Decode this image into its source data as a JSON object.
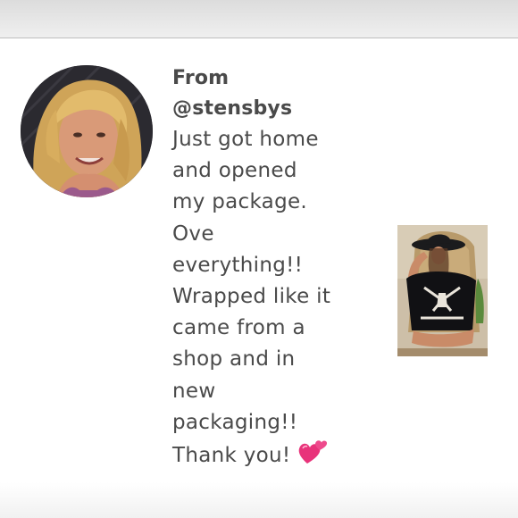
{
  "review": {
    "from_label": "From",
    "username": "@stensbys",
    "message_lines": [
      "Just got home",
      "and opened",
      "my package.",
      "Ove",
      "everything!!",
      "Wrapped like it",
      "came from a",
      "shop and in",
      "new",
      "packaging!!",
      "Thank you!"
    ],
    "emoji": "two-hearts-icon"
  },
  "colors": {
    "text": "#4a4a4a",
    "heart": "#e8337a",
    "top_bar": "#e3e3e3"
  }
}
